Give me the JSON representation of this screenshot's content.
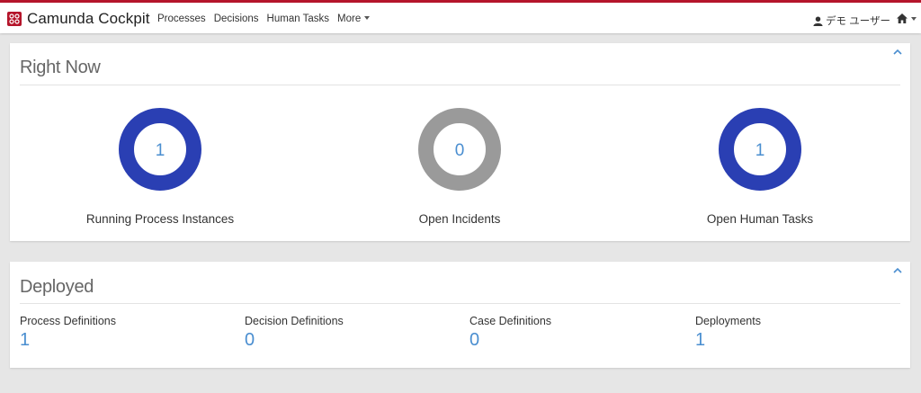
{
  "brand": {
    "title": "Camunda Cockpit",
    "logo_icon": "camunda-logo-icon"
  },
  "nav": {
    "items": [
      {
        "label": "Processes"
      },
      {
        "label": "Decisions"
      },
      {
        "label": "Human Tasks"
      },
      {
        "label": "More"
      }
    ]
  },
  "user": {
    "label": "デモ ユーザー",
    "icon": "user-icon"
  },
  "home": {
    "icon": "home-icon"
  },
  "colors": {
    "accent_red": "#b5152b",
    "donut_blue": "#2a3fb3",
    "donut_gray": "#9a9a9a",
    "value_blue": "#4a8ed0"
  },
  "right_now": {
    "title": "Right Now",
    "items": [
      {
        "value": "1",
        "label": "Running Process Instances",
        "color": "#2a3fb3"
      },
      {
        "value": "0",
        "label": "Open Incidents",
        "color": "#9a9a9a"
      },
      {
        "value": "1",
        "label": "Open Human Tasks",
        "color": "#2a3fb3"
      }
    ]
  },
  "deployed": {
    "title": "Deployed",
    "items": [
      {
        "label": "Process Definitions",
        "value": "1"
      },
      {
        "label": "Decision Definitions",
        "value": "0"
      },
      {
        "label": "Case Definitions",
        "value": "0"
      },
      {
        "label": "Deployments",
        "value": "1"
      }
    ]
  }
}
